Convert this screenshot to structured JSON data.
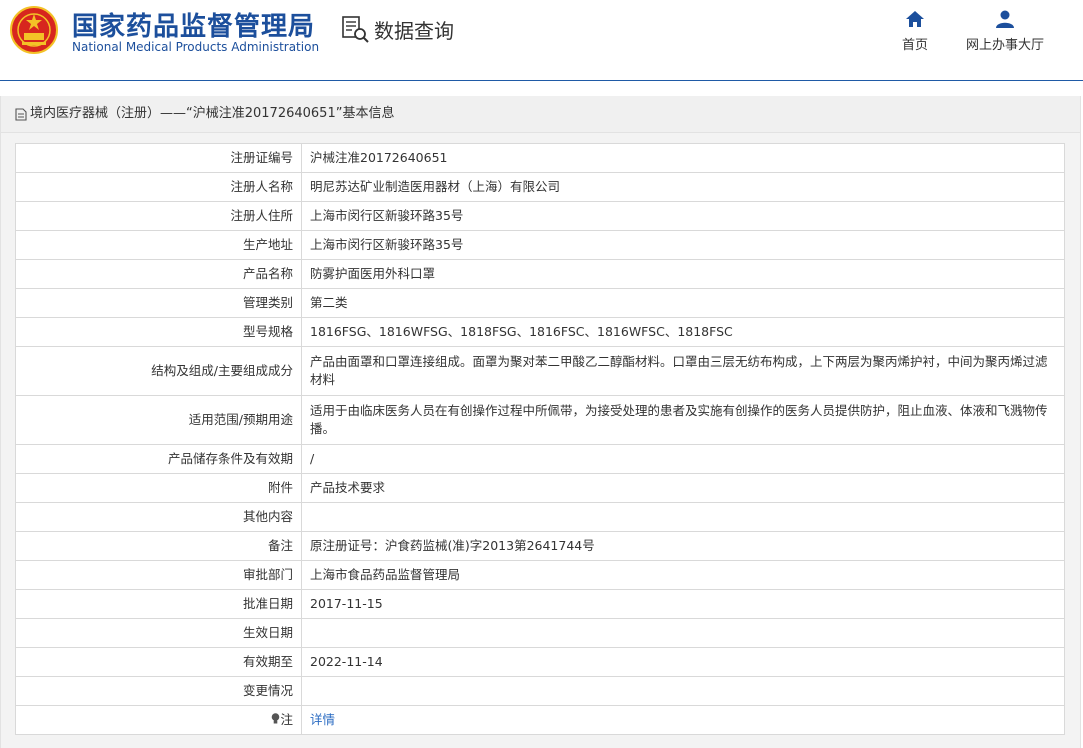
{
  "header": {
    "brand_cn": "国家药品监督管理局",
    "brand_en": "National Medical Products Administration",
    "query_label": "数据查询",
    "nav": [
      {
        "label": "首页",
        "icon": "home-icon"
      },
      {
        "label": "网上办事大厅",
        "icon": "user-icon"
      }
    ]
  },
  "section": {
    "title": "境内医疗器械（注册）——“沪械注准20172640651”基本信息"
  },
  "details": [
    {
      "label": "注册证编号",
      "value": "沪械注准20172640651"
    },
    {
      "label": "注册人名称",
      "value": "明尼苏达矿业制造医用器材（上海）有限公司"
    },
    {
      "label": "注册人住所",
      "value": "上海市闵行区新骏环路35号"
    },
    {
      "label": "生产地址",
      "value": "上海市闵行区新骏环路35号"
    },
    {
      "label": "产品名称",
      "value": "防雾护面医用外科口罩"
    },
    {
      "label": "管理类别",
      "value": "第二类"
    },
    {
      "label": "型号规格",
      "value": "1816FSG、1816WFSG、1818FSG、1816FSC、1816WFSC、1818FSC"
    },
    {
      "label": "结构及组成/主要组成成分",
      "value": "产品由面罩和口罩连接组成。面罩为聚对苯二甲酸乙二醇酯材料。口罩由三层无纺布构成，上下两层为聚丙烯护衬，中间为聚丙烯过滤材料"
    },
    {
      "label": "适用范围/预期用途",
      "value": "适用于由临床医务人员在有创操作过程中所佩带，为接受处理的患者及实施有创操作的医务人员提供防护，阻止血液、体液和飞溅物传播。"
    },
    {
      "label": "产品储存条件及有效期",
      "value": "/"
    },
    {
      "label": "附件",
      "value": "产品技术要求"
    },
    {
      "label": "其他内容",
      "value": ""
    },
    {
      "label": "备注",
      "value": "原注册证号：沪食药监械(准)字2013第2641744号"
    },
    {
      "label": "审批部门",
      "value": "上海市食品药品监督管理局"
    },
    {
      "label": "批准日期",
      "value": "2017-11-15"
    },
    {
      "label": "生效日期",
      "value": ""
    },
    {
      "label": "有效期至",
      "value": "2022-11-14"
    },
    {
      "label": "变更情况",
      "value": ""
    },
    {
      "label": "注",
      "value": "详情"
    }
  ],
  "colors": {
    "brand_blue": "#1c4f9c",
    "link_blue": "#2a6bc2",
    "emblem_red": "#d7261e",
    "emblem_gold": "#f3c227"
  }
}
